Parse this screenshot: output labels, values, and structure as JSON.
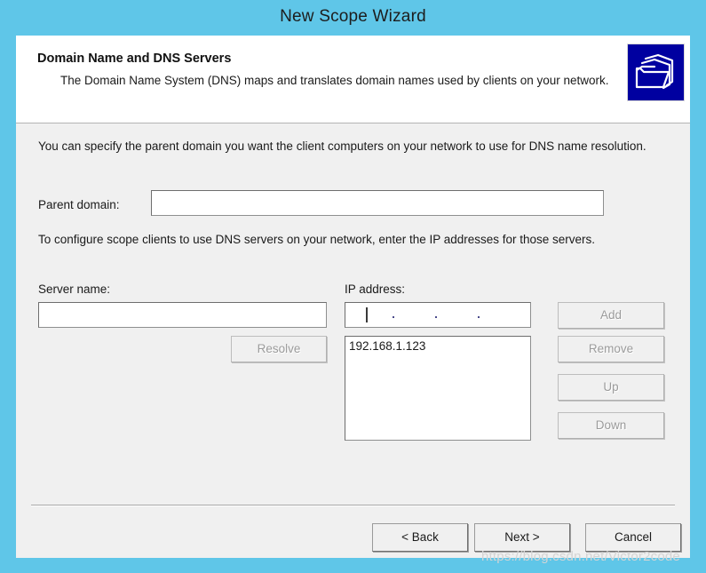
{
  "window": {
    "title": "New Scope Wizard",
    "titlebar_color": "#5FC6E8",
    "body_color": "#F0F0F0"
  },
  "header": {
    "title": "Domain Name and DNS Servers",
    "description": "The Domain Name System (DNS) maps and translates domain names used by clients on your network.",
    "icon_name": "dns-folder-stack-icon",
    "icon_background": "#0000A0"
  },
  "body": {
    "paragraph_1": "You can specify the parent domain you want the client computers on your network to use for DNS name resolution.",
    "paragraph_2": "To configure scope clients to use DNS servers on your network, enter the IP addresses for those servers.",
    "parent_domain": {
      "label": "Parent domain:",
      "value": "",
      "placeholder": ""
    },
    "server_name": {
      "label": "Server name:",
      "value": "",
      "placeholder": ""
    },
    "ip_address": {
      "label": "IP address:",
      "value": "",
      "mask_separator": "."
    },
    "ip_list": {
      "items": [
        "192.168.1.123"
      ]
    },
    "buttons": {
      "resolve": {
        "label": "Resolve",
        "enabled": false
      },
      "add": {
        "label": "Add",
        "enabled": false
      },
      "remove": {
        "label": "Remove",
        "enabled": false
      },
      "up": {
        "label": "Up",
        "enabled": false
      },
      "down": {
        "label": "Down",
        "enabled": false
      }
    }
  },
  "footer": {
    "back": "< Back",
    "next": "Next >",
    "cancel": "Cancel"
  },
  "watermark": "https://blog.csdn.net/Victor2code"
}
